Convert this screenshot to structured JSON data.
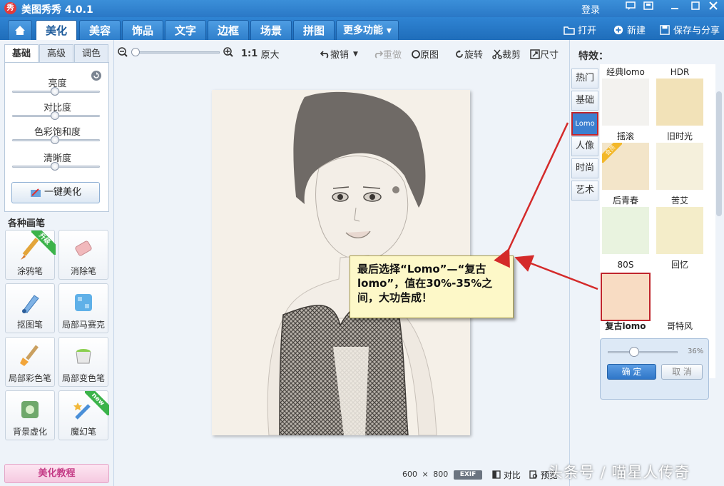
{
  "app": {
    "title": "美图秀秀 4.0.1",
    "logo_text": "秀",
    "login": "登录"
  },
  "tabs": [
    {
      "label": "美化"
    },
    {
      "label": "美容"
    },
    {
      "label": "饰品"
    },
    {
      "label": "文字"
    },
    {
      "label": "边框"
    },
    {
      "label": "场景"
    },
    {
      "label": "拼图"
    },
    {
      "label": "更多功能 ▾"
    }
  ],
  "toolbar_right": {
    "open": "打开",
    "new": "新建",
    "save_share": "保存与分享"
  },
  "left_panel": {
    "subtabs": [
      "基础",
      "高级",
      "调色"
    ],
    "sliders": [
      {
        "label": "亮度",
        "value": 0.5
      },
      {
        "label": "对比度",
        "value": 0.5
      },
      {
        "label": "色彩饱和度",
        "value": 0.5
      },
      {
        "label": "清晰度",
        "value": 0.5
      }
    ],
    "one_key_label": "一键美化",
    "brush_title": "各种画笔",
    "brushes": [
      {
        "label": "涂鸦笔",
        "badge": "升级"
      },
      {
        "label": "消除笔",
        "badge": ""
      },
      {
        "label": "抠图笔",
        "badge": ""
      },
      {
        "label": "局部马赛克",
        "badge": ""
      },
      {
        "label": "局部彩色笔",
        "badge": ""
      },
      {
        "label": "局部变色笔",
        "badge": ""
      },
      {
        "label": "背景虚化",
        "badge": ""
      },
      {
        "label": "魔幻笔",
        "badge": "new"
      }
    ],
    "tutorial": "美化教程"
  },
  "canvas": {
    "zoom_actual": "1:1",
    "zoom_actual_label": "原大",
    "undo": "撤销",
    "redo": "重做",
    "original": "原图",
    "rotate": "旋转",
    "crop": "裁剪",
    "size": "尺寸",
    "image_width": "600",
    "image_height": "800",
    "size_sep": "×",
    "exif": "EXIF",
    "compare": "对比",
    "preview": "预览"
  },
  "callout": {
    "text": "最后选择“Lomo”—“复古lomo”，值在30%-35%之间，大功告成！"
  },
  "right_panel": {
    "title": "特效：",
    "categories": [
      "热门",
      "基础",
      "Lomo",
      "人像",
      "时尚",
      "艺术"
    ],
    "active_category": "Lomo",
    "effects": [
      {
        "name": "经典lomo",
        "tint": "#f3f2ef"
      },
      {
        "name": "HDR",
        "tint": "#f2e2b8"
      },
      {
        "name": "摇滚",
        "tint": "#f3e5c9",
        "badge": "会员"
      },
      {
        "name": "旧时光",
        "tint": "#f5f0dc"
      },
      {
        "name": "后青春",
        "tint": "#e9f3df"
      },
      {
        "name": "苦艾",
        "tint": "#f4edc9"
      },
      {
        "name": "80S",
        "tint": "#f5e6cf"
      },
      {
        "name": "回忆",
        "tint": "#ffffff"
      },
      {
        "name": "复古lomo",
        "tint": "#f8dcc3",
        "selected": true
      },
      {
        "name": "哥特风",
        "tint": "#f2f6ee"
      }
    ],
    "intensity_value": "36%",
    "intensity_fraction": 0.36,
    "ok": "确 定",
    "cancel": "取 消"
  },
  "watermark": "头条号 / 喵星人传奇",
  "colors": {
    "titlebar": "#2a78c6",
    "accent": "#3c7fd0",
    "highlight_red": "#c0252c",
    "callout_bg": "#fdf8c8"
  }
}
